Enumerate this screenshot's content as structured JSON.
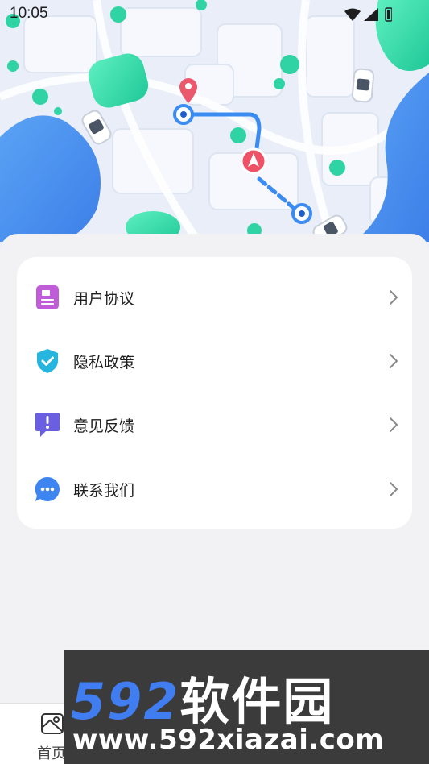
{
  "status_bar": {
    "time": "10:05"
  },
  "menu": {
    "items": [
      {
        "label": "用户协议",
        "icon": "document-icon",
        "color": "#c15cd8"
      },
      {
        "label": "隐私政策",
        "icon": "shield-check-icon",
        "color": "#25b5de"
      },
      {
        "label": "意见反馈",
        "icon": "feedback-icon",
        "color": "#6a5fe0"
      },
      {
        "label": "联系我们",
        "icon": "chat-bubble-icon",
        "color": "#3d86f2"
      }
    ]
  },
  "tabbar": {
    "home_label": "首页",
    "home_icon": "map-icon"
  },
  "watermark": {
    "logo_num": "592",
    "logo_cn": "软件园",
    "url": "www.592xiazai.com"
  }
}
